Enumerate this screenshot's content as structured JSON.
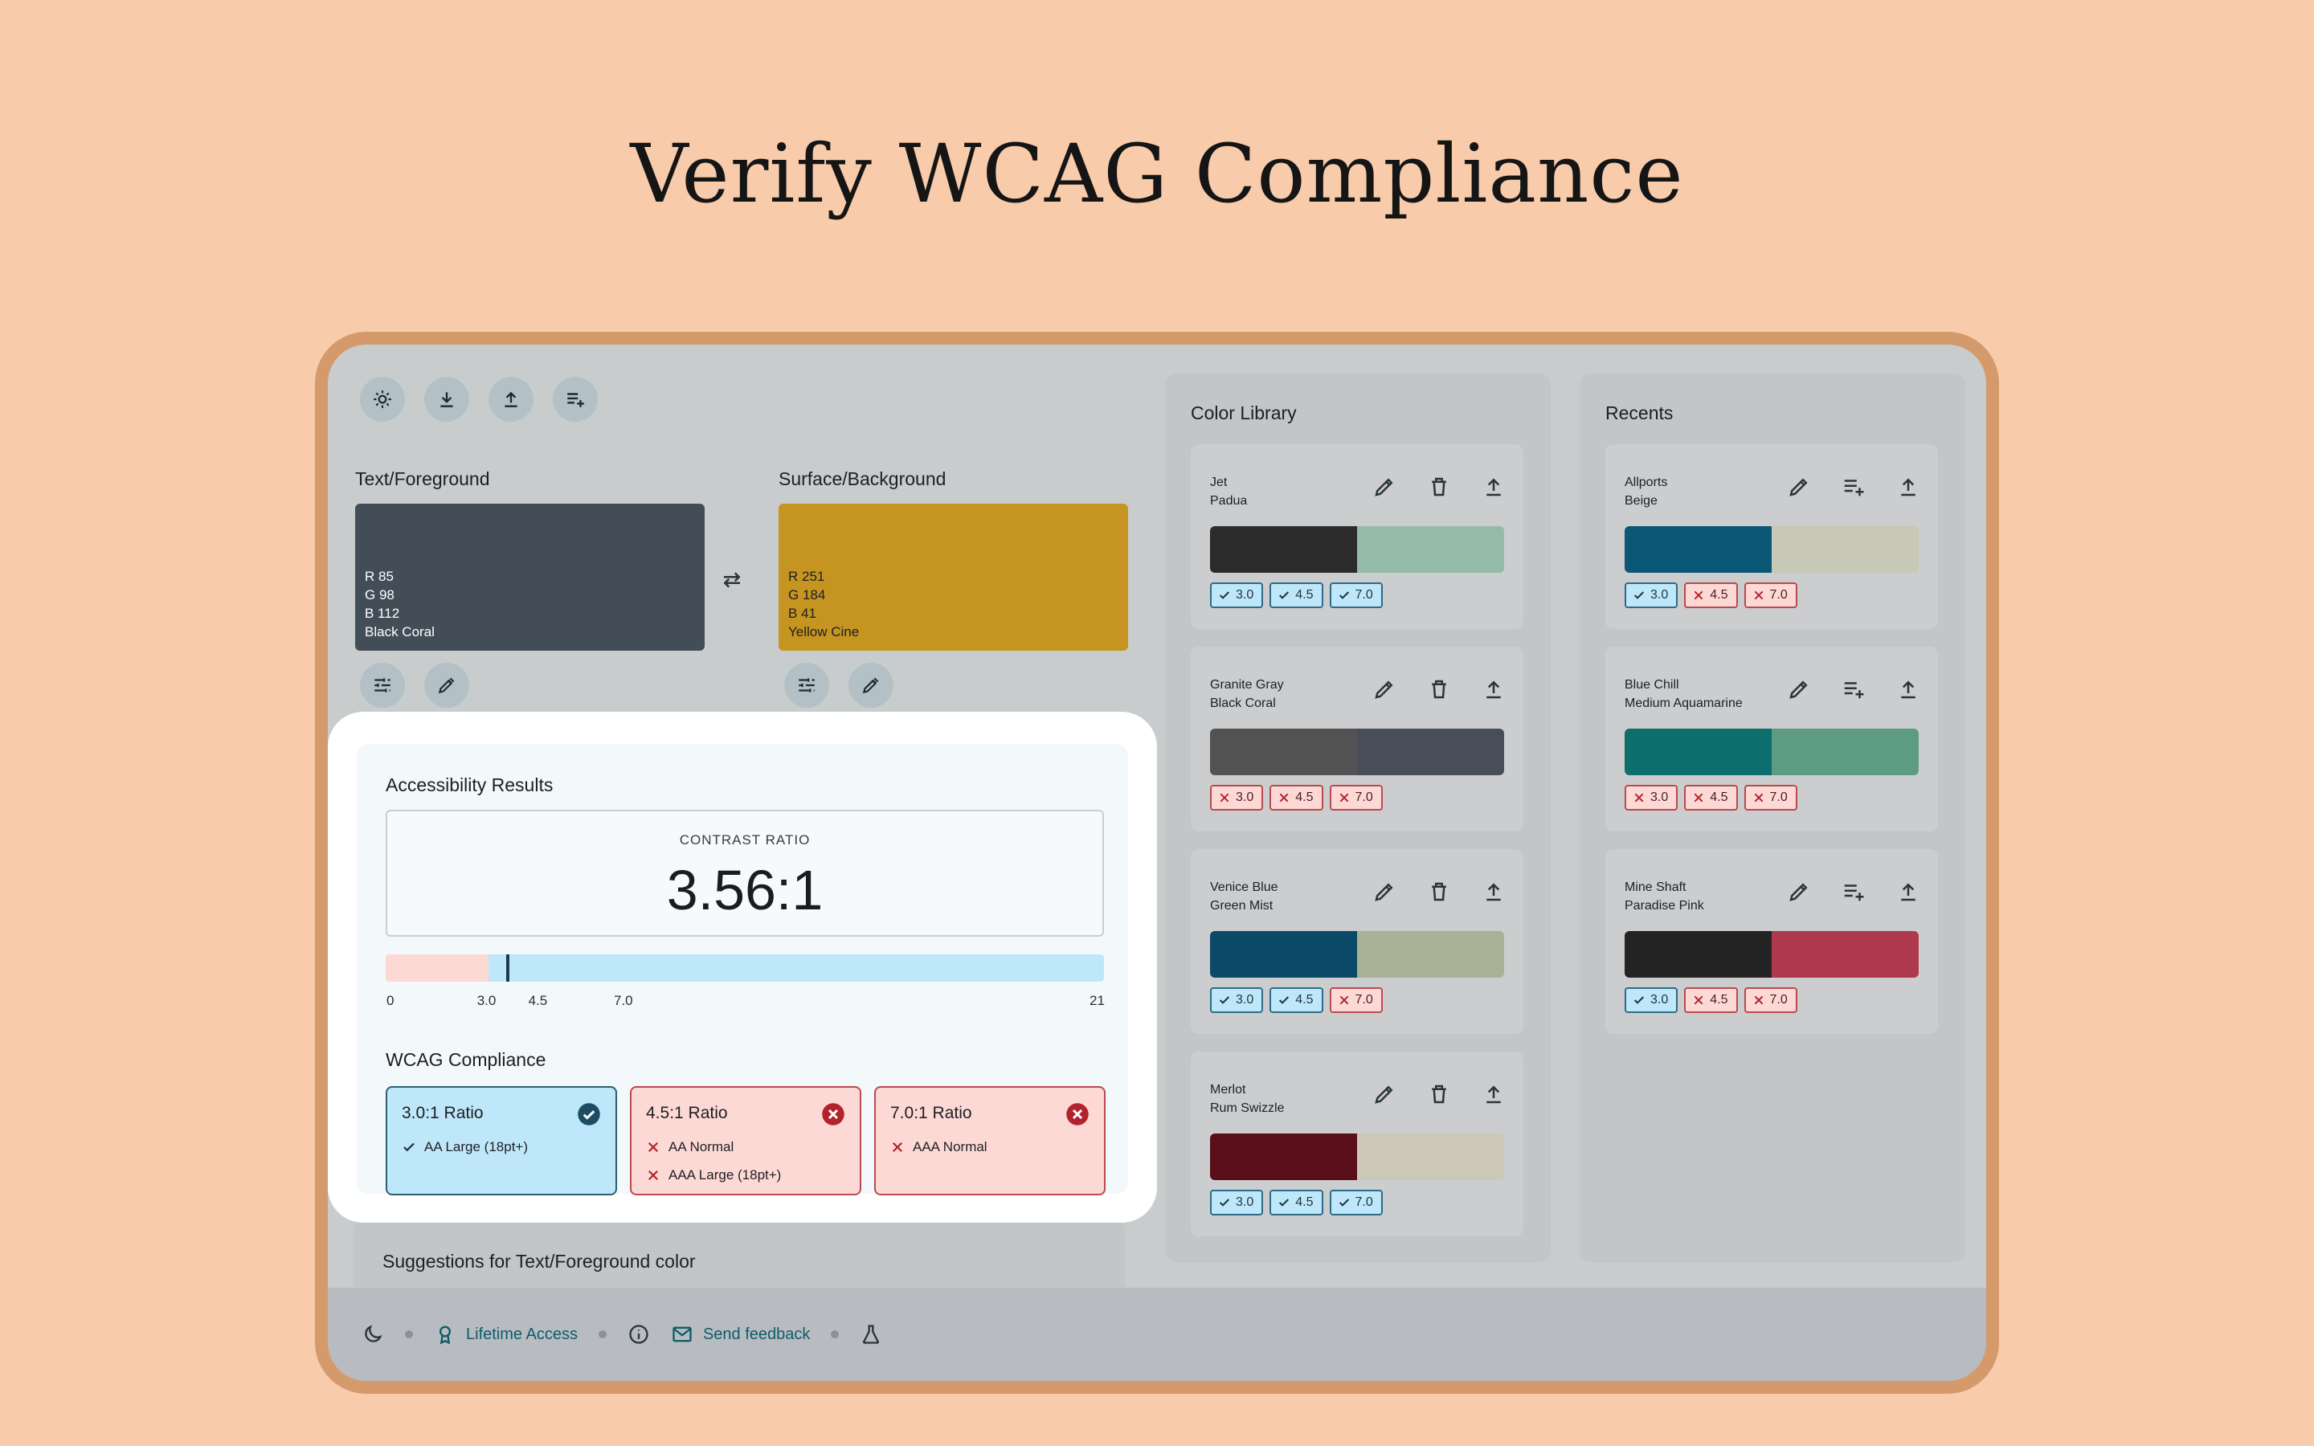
{
  "headline": "Verify WCAG Compliance",
  "toolbar": {
    "icons": [
      "brightness-icon",
      "download-icon",
      "upload-icon",
      "playlist-add-icon"
    ]
  },
  "foreground": {
    "label": "Text/Foreground",
    "color": "#555f70",
    "r": "R 85",
    "g": "G 98",
    "b": "B 112",
    "name": "Black Coral"
  },
  "background": {
    "label": "Surface/Background",
    "color": "#fbb829",
    "r": "R 251",
    "g": "G 184",
    "b": "B 41",
    "name": "Yellow Cine"
  },
  "results": {
    "title": "Accessibility Results",
    "ratio_caption": "CONTRAST RATIO",
    "ratio_value": "3.56:1",
    "ratio_number": 3.56,
    "scale_max": 21,
    "ticks": [
      "0",
      "3.0",
      "4.5",
      "7.0",
      "21"
    ]
  },
  "wcag": {
    "title": "WCAG Compliance",
    "cards": [
      {
        "title": "3.0:1 Ratio",
        "status": "pass",
        "items": [
          {
            "text": "AA Large (18pt+)",
            "pass": true
          }
        ]
      },
      {
        "title": "4.5:1 Ratio",
        "status": "fail",
        "items": [
          {
            "text": "AA Normal",
            "pass": false
          },
          {
            "text": "AAA Large (18pt+)",
            "pass": false
          }
        ]
      },
      {
        "title": "7.0:1 Ratio",
        "status": "fail",
        "items": [
          {
            "text": "AAA Normal",
            "pass": false
          }
        ]
      }
    ]
  },
  "suggestions": {
    "title": "Suggestions for Text/Foreground color"
  },
  "library": {
    "title": "Color Library",
    "pairs": [
      {
        "fg": "Jet",
        "bg": "Padua",
        "fg_color": "#343434",
        "bg_color": "#ade6c9",
        "badges": [
          {
            "label": "3.0",
            "pass": true
          },
          {
            "label": "4.5",
            "pass": true
          },
          {
            "label": "7.0",
            "pass": true
          }
        ]
      },
      {
        "fg": "Granite Gray",
        "bg": "Black Coral",
        "fg_color": "#646464",
        "bg_color": "#555f70",
        "badges": [
          {
            "label": "3.0",
            "pass": false
          },
          {
            "label": "4.5",
            "pass": false
          },
          {
            "label": "7.0",
            "pass": false
          }
        ]
      },
      {
        "fg": "Venice Blue",
        "bg": "Green Mist",
        "fg_color": "#015b88",
        "bg_color": "#cdd9b2",
        "badges": [
          {
            "label": "3.0",
            "pass": true
          },
          {
            "label": "4.5",
            "pass": true
          },
          {
            "label": "7.0",
            "pass": false
          }
        ]
      },
      {
        "fg": "Merlot",
        "bg": "Rum Swizzle",
        "fg_color": "#7b0d1e",
        "bg_color": "#f8f4dd",
        "badges": [
          {
            "label": "3.0",
            "pass": true
          },
          {
            "label": "4.5",
            "pass": true
          },
          {
            "label": "7.0",
            "pass": true
          }
        ]
      }
    ]
  },
  "recents": {
    "title": "Recents",
    "pairs": [
      {
        "fg": "Allports",
        "bg": "Beige",
        "fg_color": "#006d9a",
        "bg_color": "#f4f4db",
        "badges": [
          {
            "label": "3.0",
            "pass": true
          },
          {
            "label": "4.5",
            "pass": false
          },
          {
            "label": "7.0",
            "pass": false
          }
        ]
      },
      {
        "fg": "Blue Chill",
        "bg": "Medium Aquamarine",
        "fg_color": "#008b8b",
        "bg_color": "#68c09c",
        "badges": [
          {
            "label": "3.0",
            "pass": false
          },
          {
            "label": "4.5",
            "pass": false
          },
          {
            "label": "7.0",
            "pass": false
          }
        ]
      },
      {
        "fg": "Mine Shaft",
        "bg": "Paradise Pink",
        "fg_color": "#2b2b2b",
        "bg_color": "#e83e5d",
        "badges": [
          {
            "label": "3.0",
            "pass": true
          },
          {
            "label": "4.5",
            "pass": false
          },
          {
            "label": "7.0",
            "pass": false
          }
        ]
      }
    ]
  },
  "footer": {
    "lifetime": "Lifetime Access",
    "feedback": "Send feedback",
    "link_color": "#0f5b68"
  }
}
